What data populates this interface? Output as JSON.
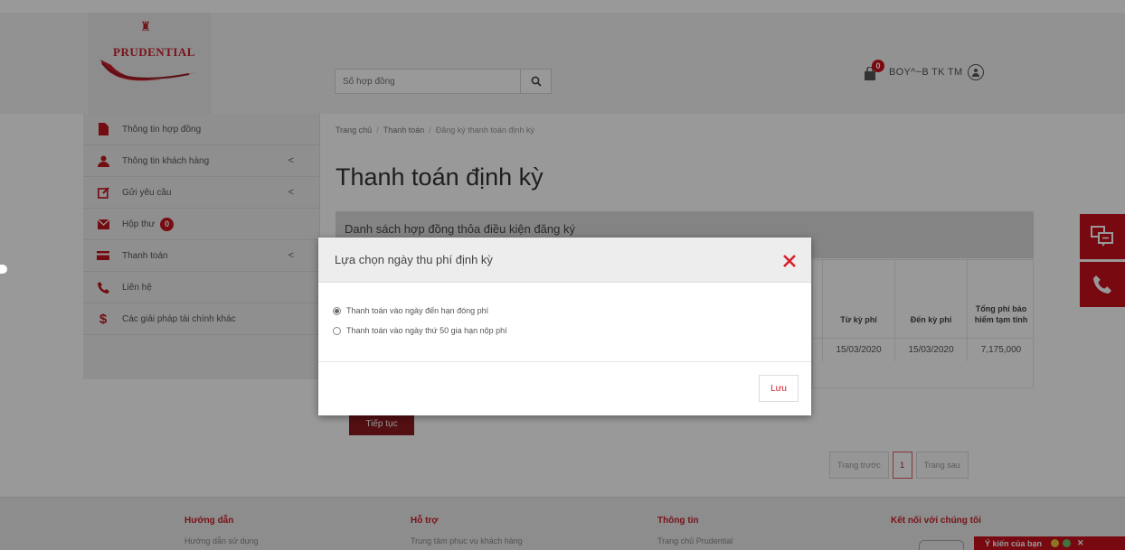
{
  "header": {
    "logo_text": "PRUDENTIAL",
    "search_placeholder": "Số hợp đồng",
    "cart_count": "0",
    "user_name": "BOY^~B TK TM"
  },
  "sidebar": {
    "items": [
      {
        "label": "Thông tin hợp đồng",
        "icon": "document-icon"
      },
      {
        "label": "Thông tin khách hàng",
        "icon": "user-icon",
        "chevron": "<"
      },
      {
        "label": "Gửi yêu cầu",
        "icon": "edit-icon",
        "chevron": "<"
      },
      {
        "label": "Hộp thư",
        "icon": "mail-icon",
        "badge": "0"
      },
      {
        "label": "Thanh toán",
        "icon": "credit-card-icon",
        "chevron": "<"
      },
      {
        "label": "Liên hệ",
        "icon": "phone-icon"
      },
      {
        "label": "Các giải pháp tài chính khác",
        "icon": "dollar-icon"
      }
    ]
  },
  "breadcrumb": {
    "home": "Trang chủ",
    "sep": "/",
    "payment": "Thanh toán",
    "current": "Đăng ký thanh toán định kỳ"
  },
  "main": {
    "title": "Thanh toán định kỳ",
    "panel_title": "Danh sách hợp đồng thỏa điều kiện đăng ký",
    "table": {
      "headers": [
        "Từ kỳ phí",
        "Đến kỳ phí",
        "Tổng phí bảo hiểm tạm tính"
      ],
      "row": [
        "15/03/2020",
        "15/03/2020",
        "7,175,000"
      ]
    },
    "continue_button": "Tiếp tục",
    "pager": {
      "prev": "Trang trước",
      "page": "1",
      "next": "Trang sau"
    }
  },
  "modal": {
    "title": "Lựa chọn ngày thu phí định kỳ",
    "option_1": "Thanh toán vào ngày đến hạn đóng phí",
    "option_2": "Thanh toán vào ngày thứ 50 gia hạn nộp phí",
    "selected_option": 1,
    "save_button": "Lưu"
  },
  "footer": {
    "col_1_title": "Hướng dẫn",
    "col_1_sub": "Hướng dẫn sử dụng",
    "col_2_title": "Hỗ trợ",
    "col_2_sub": "Trung tâm phục vụ khách hàng",
    "col_3_title": "Thông tin",
    "col_3_sub": "Trang chủ Prudential",
    "col_4_title": "Kết nối với chúng tôi",
    "feedback": "Ý kiến của bạn"
  },
  "colors": {
    "brand_red": "#c8101c",
    "dark_red_button": "#8b1a1f",
    "overlay": "rgba(0,0,0,0.40)"
  }
}
